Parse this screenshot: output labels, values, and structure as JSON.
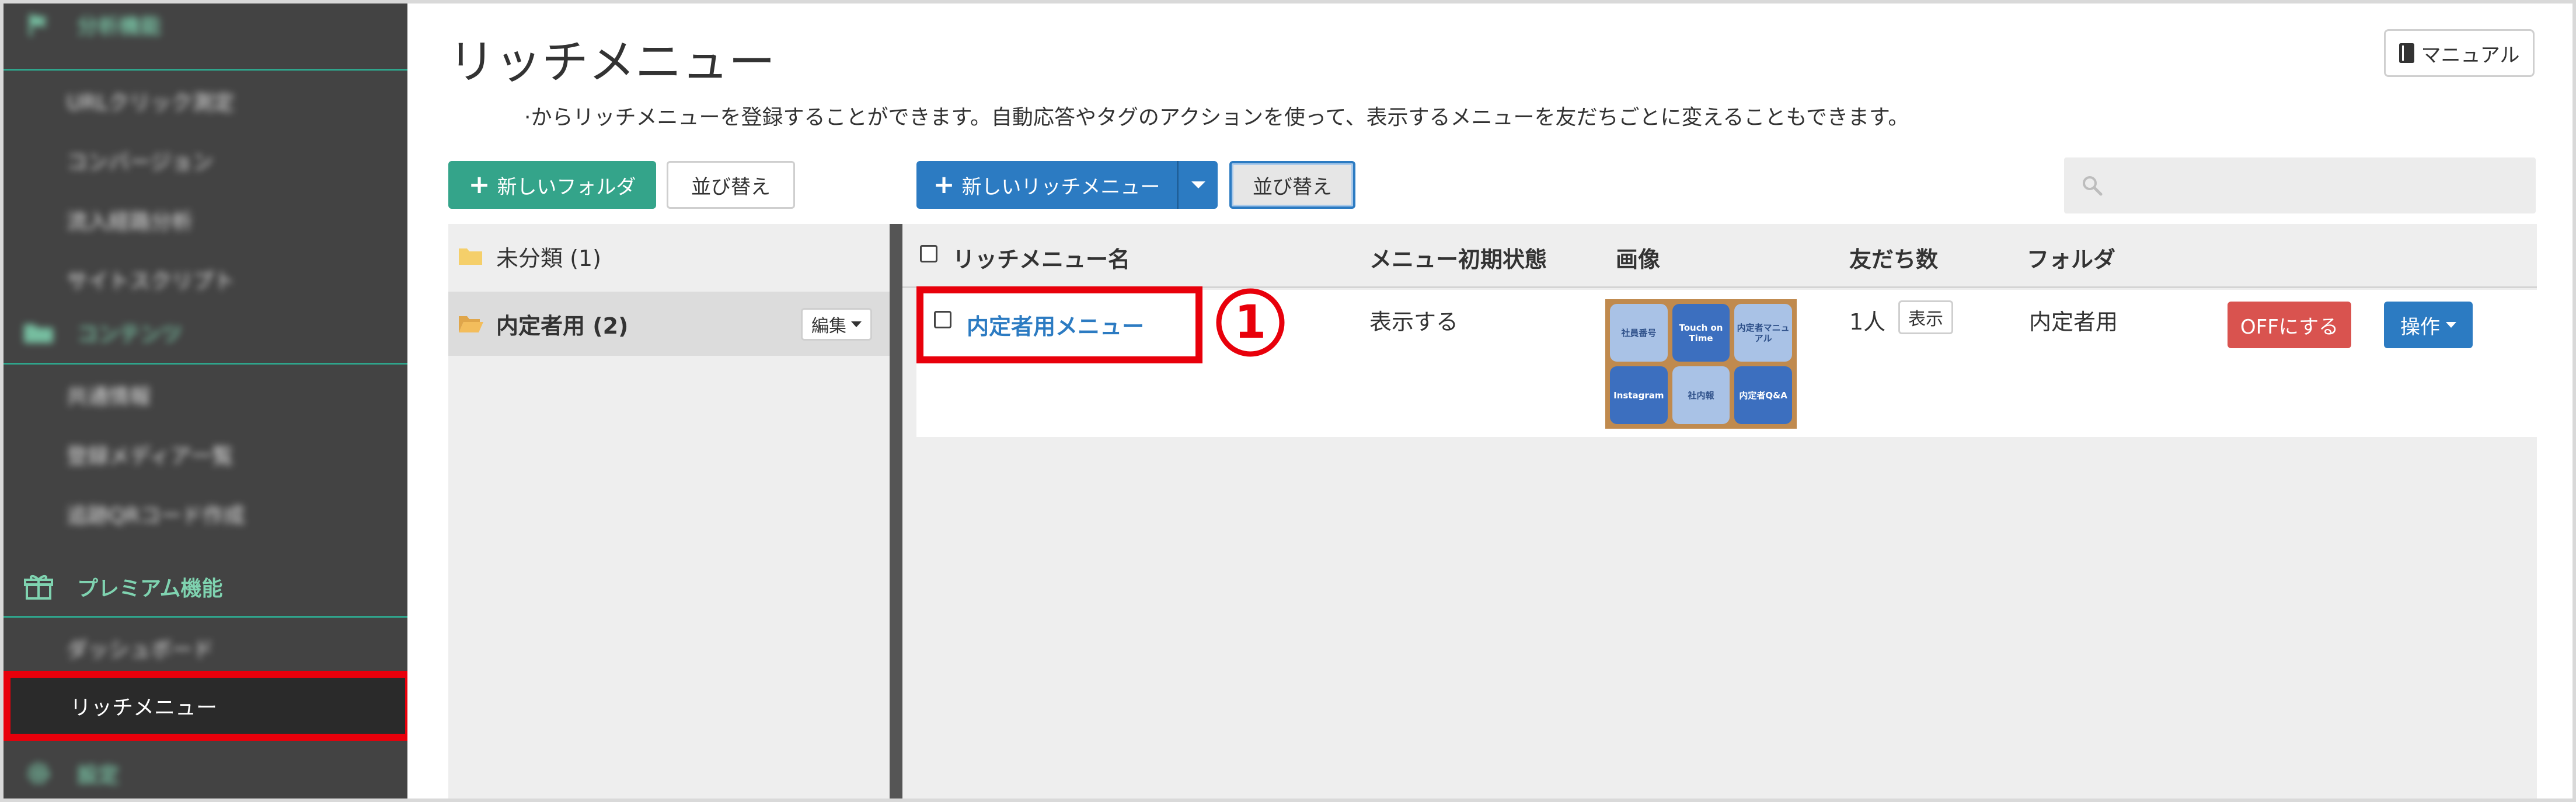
{
  "sidebar": {
    "sections": [
      {
        "label": "分析機能",
        "icon": "flag-icon"
      },
      {
        "label": "コンテンツ",
        "icon": "folder-icon"
      },
      {
        "label": "プレミアム機能",
        "icon": "gift-icon"
      },
      {
        "label": "設定",
        "icon": "gear-icon"
      }
    ],
    "analysis_items": [
      "URLクリック測定",
      "コンバージョン",
      "流入経路分析",
      "サイトスクリプト"
    ],
    "content_items": [
      "共通情報",
      "登録メディア一覧",
      "追跡QRコード作成"
    ],
    "premium_items": [
      "ダッシュボード",
      "リッチメニュー"
    ]
  },
  "header": {
    "title": "リッチメニュー",
    "manual_label": "マニュアル",
    "description": "·からリッチメニューを登録することができます。自動応答やタグのアクションを使って、表示するメニューを友だちごとに変えることもできます。"
  },
  "toolbar": {
    "new_folder_label": "新しいフォルダ",
    "folder_sort_label": "並び替え",
    "new_rich_menu_label": "新しいリッチメニュー",
    "menu_sort_label": "並び替え",
    "search_placeholder": ""
  },
  "folders": [
    {
      "name": "未分類 (1)"
    },
    {
      "name": "内定者用 (2)",
      "edit_label": "編集"
    }
  ],
  "table": {
    "headers": [
      "リッチメニュー名",
      "メニュー初期状態",
      "画像",
      "友だち数",
      "フォルダ"
    ],
    "rows": [
      {
        "name": "内定者用メニュー",
        "initial_state": "表示する",
        "friends": "1人",
        "view_label": "表示",
        "folder": "内定者用",
        "off_label": "OFFにする",
        "ops_label": "操作",
        "thumbnail_tiles": [
          {
            "label": "社員番号",
            "style": "light"
          },
          {
            "label": "Touch on Time",
            "style": "dark"
          },
          {
            "label": "内定者マニュアル",
            "style": "light"
          },
          {
            "label": "Instagram",
            "style": "dark"
          },
          {
            "label": "社内報",
            "style": "light"
          },
          {
            "label": "内定者Q&A",
            "style": "dark"
          }
        ]
      }
    ]
  },
  "annotation": {
    "step": "①",
    "color": "#e8000b"
  },
  "colors": {
    "green": "#34a48a",
    "blue": "#2c7bc2",
    "red": "#d9534f",
    "sidebar": "#434343",
    "accent_text": "#7fd3b0"
  }
}
